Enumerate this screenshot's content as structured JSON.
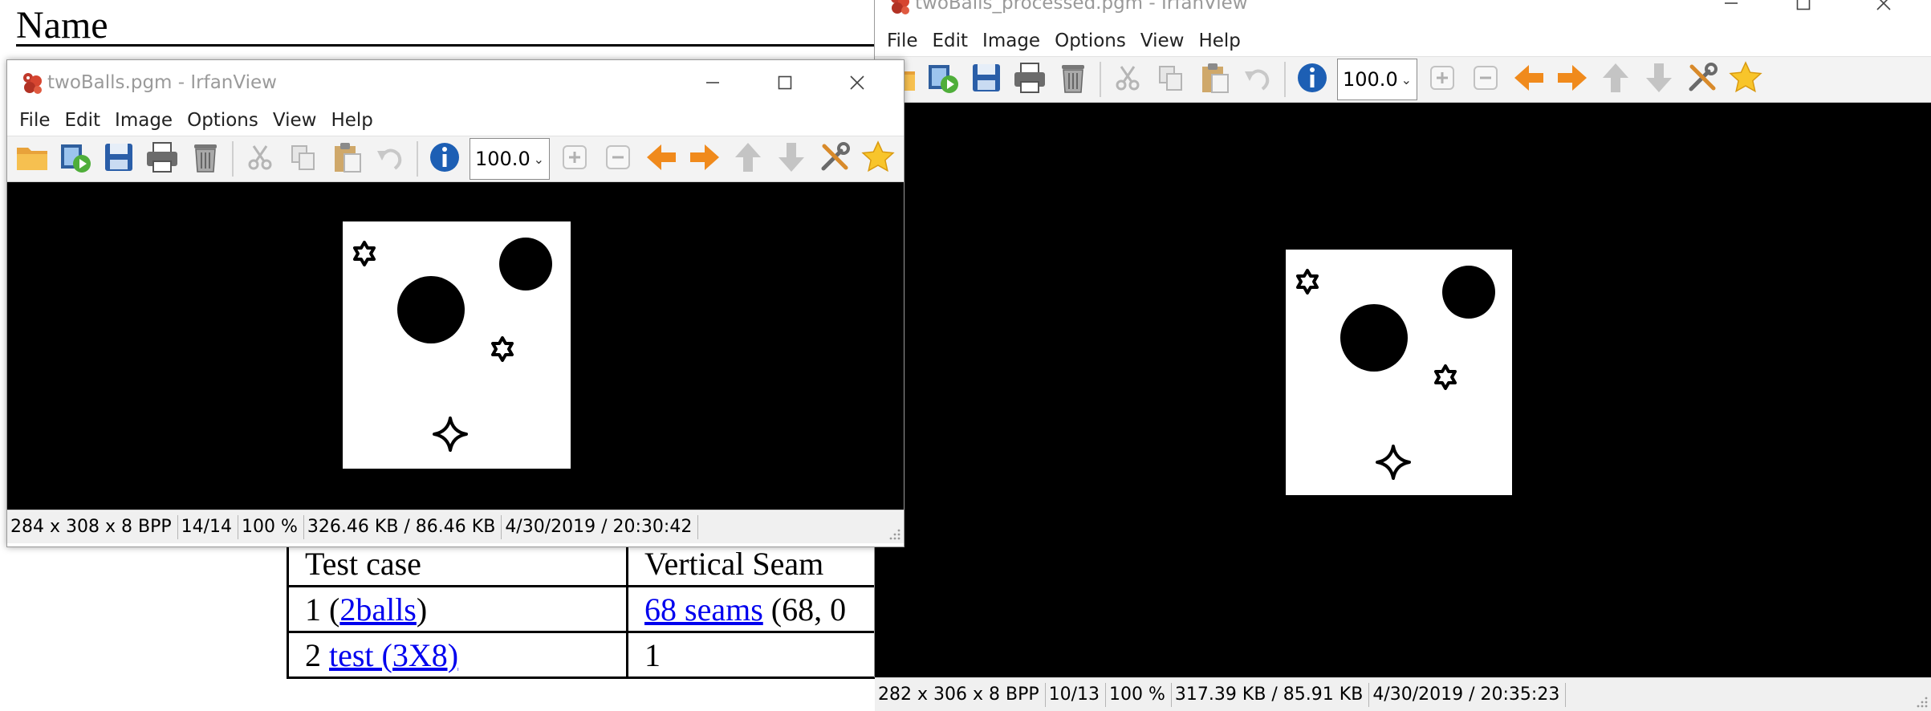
{
  "document": {
    "heading": "Name",
    "table": {
      "rows": [
        {
          "c1": {
            "text": "Test case"
          },
          "c2": {
            "text": "Vertical Seam"
          }
        },
        {
          "c1": {
            "pre": "1 (",
            "link": "2balls",
            "post": ")"
          },
          "c2": {
            "link": "68 seams",
            "post": " (68, 0"
          }
        },
        {
          "c1": {
            "pre": "2 ",
            "link": "test (3X8)",
            "post": ""
          },
          "c2": {
            "text": "1"
          }
        }
      ]
    }
  },
  "windows": [
    {
      "id": "left",
      "title": "twoBalls.pgm - IrfanView",
      "menu": [
        "File",
        "Edit",
        "Image",
        "Options",
        "View",
        "Help"
      ],
      "zoom": "100.0",
      "status": [
        "284 x 308 x 8 BPP",
        "14/14",
        "100 %",
        "326.46 KB / 86.46 KB",
        "4/30/2019 / 20:30:42"
      ]
    },
    {
      "id": "right",
      "title": "twoBalls_processed.pgm - IrfanView",
      "menu": [
        "File",
        "Edit",
        "Image",
        "Options",
        "View",
        "Help"
      ],
      "zoom": "100.0",
      "status": [
        "282 x 306 x 8 BPP",
        "10/13",
        "100 %",
        "317.39 KB / 85.91 KB",
        "4/30/2019 / 20:35:23"
      ]
    }
  ],
  "toolbar_icons": [
    "open-folder-icon",
    "slideshow-icon",
    "save-icon",
    "print-icon",
    "delete-icon",
    "cut-icon",
    "copy-icon",
    "paste-icon",
    "undo-icon",
    "info-icon",
    "zoom-in-icon",
    "zoom-out-icon",
    "previous-icon",
    "next-icon",
    "first-icon",
    "last-icon",
    "settings-icon",
    "favorite-icon"
  ],
  "colors": {
    "viewport_background": "#000000",
    "image_background": "#ffffff",
    "link": "#0000ee",
    "accent_orange": "#f08a1c",
    "info_blue": "#1d5fb4"
  }
}
